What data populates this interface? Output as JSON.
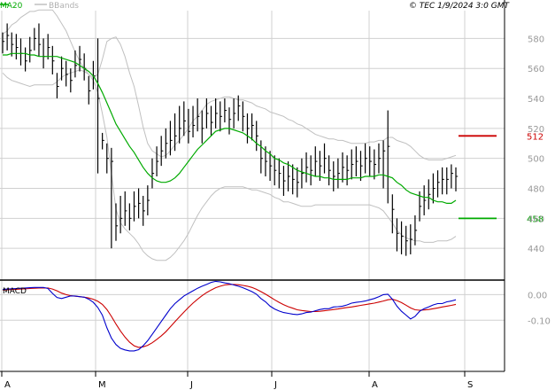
{
  "header": {
    "legend_ma": "MA20",
    "legend_bb": "BBands",
    "copyright": "© TEC 1/9/2024 3:0 GMT"
  },
  "colors": {
    "ma": "#00aa00",
    "bands": "#c0c0c0",
    "price": "#000000",
    "macd": "#0000cc",
    "signal": "#cc0000",
    "grid": "#d0d0d0",
    "resistance": "#cc0000",
    "support": "#00aa00"
  },
  "chart_data": [
    {
      "type": "ohlc",
      "title": "",
      "ylim": [
        420,
        595
      ],
      "y_ticks": [
        440,
        460,
        480,
        500,
        520,
        540,
        560,
        580
      ],
      "x_ticks": [
        "A",
        "M",
        "J",
        "J",
        "A",
        "S"
      ],
      "grid": true,
      "levels": [
        {
          "label": "512",
          "value": 515,
          "role": "resistance"
        },
        {
          "label": "458",
          "value": 460,
          "role": "support"
        }
      ],
      "series": [
        {
          "key": "close",
          "values": [
            578,
            582,
            576,
            574,
            570,
            565,
            572,
            580,
            576,
            568,
            574,
            565,
            548,
            560,
            556,
            552,
            562,
            566,
            560,
            545,
            555,
            540,
            512,
            500,
            498,
            455,
            460,
            465,
            460,
            468,
            470,
            465,
            472,
            490,
            498,
            505,
            510,
            512,
            515,
            520,
            525,
            518,
            522,
            528,
            520,
            530,
            524,
            530,
            528,
            532,
            526,
            530,
            535,
            528,
            520,
            522,
            515,
            500,
            498,
            495,
            492,
            490,
            485,
            488,
            486,
            484,
            490,
            494,
            492,
            498,
            495,
            500,
            492,
            488,
            490,
            494,
            492,
            496,
            498,
            495,
            500,
            498,
            496,
            500,
            505,
            508,
            466,
            450,
            448,
            445,
            446,
            452,
            468,
            472,
            476,
            480,
            484,
            486,
            486,
            490,
            488
          ]
        },
        {
          "key": "high",
          "values": [
            584,
            590,
            584,
            583,
            580,
            574,
            581,
            587,
            590,
            580,
            583,
            575,
            557,
            568,
            565,
            560,
            572,
            575,
            570,
            555,
            565,
            580,
            517,
            510,
            507,
            470,
            475,
            478,
            470,
            478,
            480,
            475,
            482,
            500,
            508,
            515,
            520,
            525,
            530,
            535,
            538,
            533,
            535,
            540,
            532,
            540,
            535,
            540,
            538,
            540,
            534,
            540,
            542,
            538,
            530,
            530,
            525,
            512,
            508,
            505,
            502,
            500,
            495,
            498,
            496,
            494,
            500,
            504,
            502,
            508,
            505,
            510,
            502,
            498,
            500,
            504,
            502,
            506,
            508,
            505,
            510,
            508,
            506,
            510,
            512,
            532,
            476,
            460,
            458,
            455,
            456,
            462,
            478,
            482,
            486,
            490,
            492,
            494,
            494,
            496,
            494
          ]
        },
        {
          "key": "low",
          "values": [
            570,
            572,
            568,
            566,
            562,
            558,
            564,
            572,
            568,
            560,
            566,
            556,
            540,
            552,
            548,
            544,
            554,
            558,
            552,
            536,
            546,
            490,
            506,
            490,
            440,
            445,
            450,
            455,
            452,
            458,
            460,
            455,
            462,
            480,
            488,
            495,
            500,
            502,
            505,
            510,
            515,
            510,
            514,
            518,
            510,
            520,
            515,
            520,
            518,
            524,
            516,
            520,
            525,
            518,
            510,
            512,
            505,
            490,
            488,
            485,
            482,
            480,
            475,
            478,
            476,
            474,
            480,
            484,
            482,
            488,
            485,
            490,
            482,
            478,
            480,
            484,
            482,
            486,
            488,
            485,
            490,
            488,
            486,
            490,
            480,
            470,
            450,
            438,
            436,
            435,
            436,
            442,
            458,
            462,
            466,
            470,
            474,
            476,
            476,
            480,
            478
          ]
        },
        {
          "key": "ma20",
          "values": [
            569,
            569,
            570,
            570,
            570,
            570,
            569,
            569,
            568,
            568,
            568,
            568,
            568,
            567,
            566,
            565,
            564,
            562,
            560,
            558,
            555,
            550,
            544,
            537,
            530,
            523,
            518,
            513,
            508,
            504,
            499,
            494,
            490,
            487,
            485,
            484,
            484,
            485,
            487,
            490,
            494,
            498,
            502,
            506,
            509,
            512,
            515,
            518,
            519,
            520,
            520,
            519,
            518,
            517,
            515,
            513,
            510,
            508,
            505,
            503,
            500,
            499,
            497,
            496,
            494,
            492,
            491,
            490,
            489,
            488,
            488,
            487,
            487,
            486,
            486,
            486,
            486,
            487,
            487,
            487,
            488,
            488,
            488,
            489,
            489,
            488,
            487,
            484,
            482,
            479,
            477,
            476,
            475,
            474,
            474,
            472,
            471,
            471,
            470,
            470,
            472
          ]
        },
        {
          "key": "bb_upper",
          "values": [
            583,
            585,
            589,
            591,
            594,
            596,
            598,
            598,
            599,
            599,
            599,
            599,
            595,
            590,
            585,
            578,
            571,
            565,
            560,
            556,
            554,
            556,
            566,
            578,
            580,
            581,
            576,
            568,
            557,
            548,
            535,
            521,
            510,
            505,
            503,
            501,
            502,
            505,
            509,
            512,
            516,
            520,
            525,
            528,
            532,
            536,
            538,
            539,
            540,
            541,
            541,
            540,
            539,
            539,
            538,
            537,
            535,
            534,
            533,
            531,
            530,
            529,
            528,
            526,
            525,
            523,
            522,
            520,
            518,
            516,
            515,
            514,
            513,
            513,
            512,
            512,
            511,
            510,
            510,
            510,
            510,
            511,
            511,
            512,
            512,
            514,
            514,
            512,
            511,
            510,
            508,
            505,
            502,
            500,
            499,
            499,
            499,
            499,
            500,
            501,
            502
          ]
        },
        {
          "key": "bb_lower",
          "values": [
            557,
            554,
            552,
            551,
            550,
            549,
            548,
            549,
            549,
            549,
            549,
            549,
            551,
            554,
            556,
            557,
            558,
            559,
            558,
            556,
            552,
            544,
            530,
            514,
            490,
            466,
            457,
            453,
            450,
            447,
            443,
            438,
            435,
            433,
            432,
            432,
            432,
            434,
            437,
            441,
            445,
            450,
            456,
            462,
            467,
            471,
            475,
            478,
            480,
            481,
            481,
            481,
            481,
            481,
            480,
            479,
            479,
            478,
            477,
            476,
            474,
            473,
            471,
            471,
            470,
            469,
            468,
            468,
            468,
            469,
            469,
            469,
            469,
            469,
            469,
            469,
            469,
            469,
            469,
            469,
            469,
            469,
            468,
            467,
            465,
            461,
            457,
            452,
            449,
            447,
            446,
            445,
            445,
            444,
            444,
            444,
            445,
            445,
            445,
            446,
            448
          ]
        }
      ]
    },
    {
      "type": "line",
      "title": "MACD",
      "ylim": [
        -30,
        5
      ],
      "y_ticks": [
        {
          "label": "0.00",
          "value": 0
        },
        {
          "label": "-0.10",
          "value": -10
        }
      ],
      "grid": true,
      "series": [
        {
          "key": "macd",
          "values": [
            2,
            2.2,
            2.3,
            2.4,
            2.5,
            2.6,
            2.7,
            2.8,
            2.8,
            2.8,
            2.4,
            0.5,
            -1.1,
            -1.5,
            -1.0,
            -0.5,
            -0.5,
            -0.8,
            -1.0,
            -1.8,
            -3,
            -5,
            -8,
            -13,
            -17,
            -19.5,
            -21,
            -21.6,
            -22,
            -22,
            -21.5,
            -20,
            -18,
            -15.5,
            -13,
            -10.5,
            -8,
            -5.5,
            -3.5,
            -2,
            -0.5,
            0.5,
            1.5,
            2.5,
            3.3,
            4.0,
            4.8,
            5.2,
            5.0,
            4.6,
            4.3,
            3.8,
            3.3,
            2.7,
            2.0,
            1.2,
            0.2,
            -1.5,
            -2.8,
            -4.5,
            -5.6,
            -6.4,
            -7.0,
            -7.3,
            -7.6,
            -7.8,
            -7.5,
            -7.0,
            -6.8,
            -6.3,
            -5.8,
            -5.5,
            -5.5,
            -4.8,
            -4.7,
            -4.5,
            -4.0,
            -3.3,
            -3.0,
            -2.8,
            -2.5,
            -2.0,
            -1.5,
            -0.8,
            0.0,
            0.2,
            -1.8,
            -4.5,
            -6.5,
            -8,
            -9.5,
            -8.5,
            -6.5,
            -5.5,
            -4.8,
            -4.0,
            -3.5,
            -3.5,
            -2.8,
            -2.5,
            -2.0
          ]
        },
        {
          "key": "signal",
          "values": [
            1.8,
            1.9,
            2.0,
            2.1,
            2.2,
            2.3,
            2.4,
            2.5,
            2.6,
            2.6,
            2.6,
            2.2,
            1.5,
            0.6,
            0.0,
            -0.4,
            -0.6,
            -0.8,
            -1.0,
            -1.3,
            -1.8,
            -2.6,
            -3.8,
            -5.8,
            -8.5,
            -11.5,
            -14.2,
            -16.6,
            -18.6,
            -20.0,
            -20.6,
            -20.4,
            -19.8,
            -18.8,
            -17.5,
            -16.1,
            -14.5,
            -12.6,
            -10.6,
            -8.7,
            -6.8,
            -5.0,
            -3.3,
            -1.8,
            -0.4,
            0.8,
            1.8,
            2.7,
            3.3,
            3.8,
            4.0,
            4.0,
            3.9,
            3.6,
            3.3,
            2.8,
            2.1,
            1.2,
            0.2,
            -0.9,
            -2.0,
            -3.0,
            -3.9,
            -4.7,
            -5.3,
            -5.9,
            -6.2,
            -6.4,
            -6.6,
            -6.6,
            -6.5,
            -6.3,
            -6.1,
            -5.8,
            -5.6,
            -5.3,
            -5.0,
            -4.8,
            -4.5,
            -4.2,
            -3.9,
            -3.6,
            -3.3,
            -2.9,
            -2.5,
            -2.0,
            -1.8,
            -2.3,
            -3.1,
            -4.1,
            -5.2,
            -5.9,
            -6.1,
            -6.0,
            -5.8,
            -5.5,
            -5.2,
            -4.8,
            -4.5,
            -4.2,
            -3.8
          ]
        }
      ]
    }
  ]
}
